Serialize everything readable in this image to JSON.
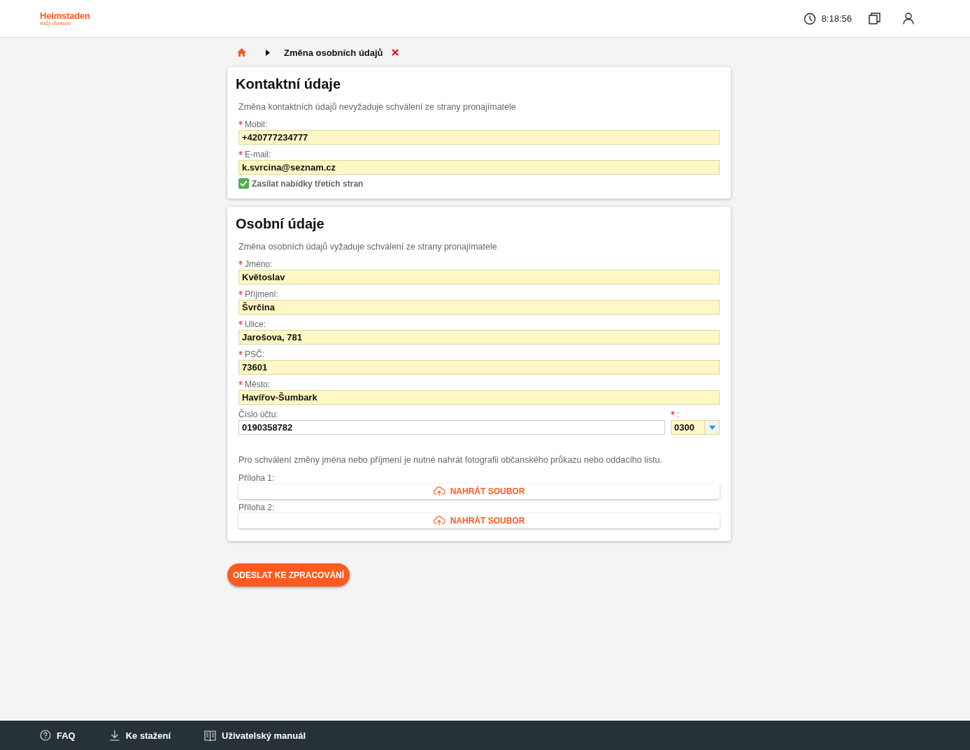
{
  "header": {
    "logo": "Heimstaden",
    "logo_tagline": "můj domov",
    "time": "8:18:56"
  },
  "breadcrumb": {
    "current": "Změna osobních údajů"
  },
  "cards": [
    {
      "title": "Kontaktní údaje",
      "note": "Změna kontaktních údajů nevyžaduje schválení ze strany pronajímatele",
      "fields": [
        {
          "kind": "text",
          "label": "Mobil:",
          "required": true,
          "value": "+420777234777",
          "highlighted": true
        },
        {
          "kind": "text",
          "label": "E-mail:",
          "required": true,
          "value": "k.svrcina@seznam.cz",
          "highlighted": true
        },
        {
          "kind": "checkbox",
          "label": "Zasílat nabídky třetích stran",
          "checked": true
        }
      ]
    },
    {
      "title": "Osobní údaje",
      "note": "Změna osobních údajů vyžaduje schválení ze strany pronajímatele",
      "fields": [
        {
          "kind": "text",
          "label": "Jméno:",
          "required": true,
          "value": "Květoslav",
          "highlighted": true
        },
        {
          "kind": "text",
          "label": "Příjmení:",
          "required": true,
          "value": "Švrčina",
          "highlighted": true
        },
        {
          "kind": "text",
          "label": "Ulice:",
          "required": true,
          "value": "Jarošova, 781",
          "highlighted": true
        },
        {
          "kind": "text",
          "label": "PSČ:",
          "required": true,
          "value": "73601",
          "highlighted": true
        },
        {
          "kind": "text",
          "label": "Město:",
          "required": true,
          "value": "Havířov-Šumbark",
          "highlighted": true
        },
        {
          "kind": "account",
          "label": "Číslo účtu:",
          "required": false,
          "value": "0190358782",
          "highlighted": false,
          "bank_code": {
            "label": ":",
            "required": true,
            "value": "0300",
            "highlighted": true
          }
        },
        {
          "kind": "note",
          "text": "Pro schválení změny jména nebo příjmení je nutné nahrát fotografii občanského průkazu nebo oddacího listu."
        },
        {
          "kind": "upload",
          "label": "Příloha 1:",
          "button": "NAHRÁT SOUBOR"
        },
        {
          "kind": "upload",
          "label": "Příloha 2:",
          "button": "NAHRÁT SOUBOR"
        }
      ]
    }
  ],
  "submit": "ODESLAT KE ZPRACOVÁNÍ",
  "footer": [
    {
      "kind": "faq",
      "label": "FAQ"
    },
    {
      "kind": "download",
      "label": "Ke stažení"
    },
    {
      "kind": "manual",
      "label": "Uživatelský manuál"
    }
  ]
}
